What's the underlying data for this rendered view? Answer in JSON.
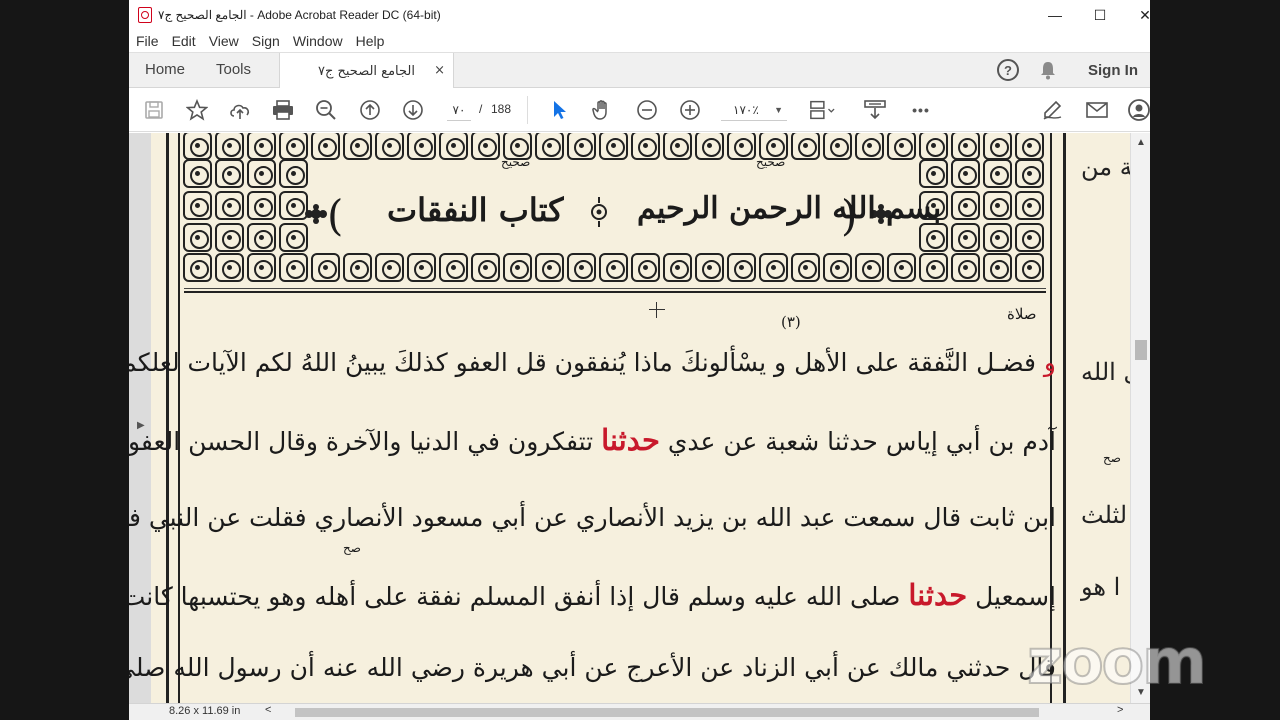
{
  "window": {
    "title": "الجامع الصحيح ج٧ - Adobe Acrobat Reader DC (64-bit)",
    "minimize": "—",
    "maximize": "☐",
    "close": "✕"
  },
  "menu": [
    "File",
    "Edit",
    "View",
    "Sign",
    "Window",
    "Help"
  ],
  "tabs": {
    "home": "Home",
    "tools": "Tools",
    "document": "الجامع الصحيح ج٧",
    "close": "×",
    "help": "?",
    "sign_in": "Sign In"
  },
  "toolbar": {
    "page_current": "٧٠",
    "page_sep": "/",
    "page_total": "188",
    "zoom": "١٧٠٪",
    "zoom_caret": "▼",
    "more": "•••"
  },
  "document": {
    "top_notes": [
      "صحيح",
      "صحيح"
    ],
    "basmala": "بسم الله الرحمن الرحيم",
    "book_title": "كتاب النفقات",
    "page_note": "(٣)",
    "corner_note": "صلاة",
    "lines": [
      {
        "red": "و",
        "text": "فضـل النَّفقة على الأهل و يسْألونكَ ماذا يُنفقون قل العفو كذلكَ يبينُ اللهُ لكم الآيات لعلكم"
      },
      {
        "red": "حدثنا",
        "text": "تتفكرون في الدنيا والآخرة وقال الحسن العفو الفضل",
        "text2": "آدم بن أبي إياس حدثنا شعبة عن عدي"
      },
      {
        "red": "",
        "text": "ابن ثابت قال سمعت عبد الله بن يزيد الأنصاري عن أبي مسعود الأنصاري فقلت عن النبي فقال عن النبي"
      },
      {
        "red": "حدثنا",
        "text": "صلى الله عليه وسلم قال إذا أنفق المسلم نفقة على أهله وهو يحتسبها كانت له صدقة",
        "text2": "إسمعيل"
      },
      {
        "red": "",
        "text": "قال حدثني مالك عن أبي الزناد عن الأعرج عن أبي هريرة رضي الله عنه أن رسول الله صلى الله عليه"
      }
    ],
    "margin": [
      "ـة من",
      "ل الله",
      "لثلث",
      "ا هو"
    ],
    "margin_note": "صح"
  },
  "status": {
    "size": "8.26 x 11.69 in",
    "left_arrow": "<",
    "right_arrow": ">"
  },
  "overlay": {
    "watermark": "zoom"
  }
}
